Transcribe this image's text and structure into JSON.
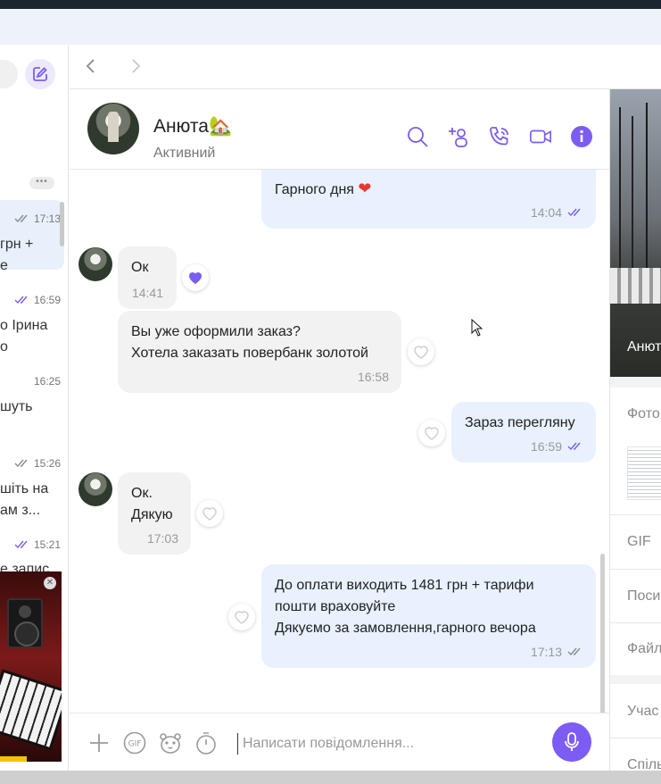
{
  "sidebar": {
    "more_label": "•••",
    "items": [
      {
        "time": "17:13",
        "text": "грн +\nе",
        "read": true,
        "active": true
      },
      {
        "time": "16:59",
        "text": "о Ірина\nо",
        "read": true,
        "active": false
      },
      {
        "time": "16:25",
        "text": "шуть",
        "read": false,
        "active": false
      },
      {
        "time": "15:26",
        "text": "шіть на\nам з...",
        "read": true,
        "active": false
      },
      {
        "time": "15:21",
        "text": "е запис",
        "read": true,
        "active": false
      }
    ],
    "ad_close": "✕"
  },
  "header": {
    "name": "Анюта",
    "name_emoji": "🏡",
    "status": "Активний"
  },
  "messages": [
    {
      "dir": "out",
      "text": "Гарного дня",
      "emoji": "❤",
      "time": "14:04"
    },
    {
      "dir": "in",
      "text": "Ок",
      "time": "14:41",
      "liked": true
    },
    {
      "dir": "in",
      "text": "Вы уже оформили заказ?\nХотела заказать повербанк золотой",
      "time": "16:58"
    },
    {
      "dir": "out",
      "text": "Зараз перегляну",
      "time": "16:59"
    },
    {
      "dir": "in",
      "text": "Ок.\nДякую",
      "time": "17:03"
    },
    {
      "dir": "out",
      "text": "До оплати виходить 1481 грн + тарифи\nпошти враховуйте\nДякуємо за замовлення,гарного вечора",
      "time": "17:13"
    }
  ],
  "composer": {
    "placeholder": "Написати повідомлення..."
  },
  "right_panel": {
    "photo_name": "Анют",
    "items": [
      "Фото",
      "GIF",
      "Поси",
      "Файл",
      "Учас",
      "Спіль"
    ]
  },
  "colors": {
    "accent": "#7c5cf2",
    "outgoing_bubble": "#e8f1fd",
    "incoming_bubble": "#f2f2f2",
    "heart_red": "#e53935"
  }
}
